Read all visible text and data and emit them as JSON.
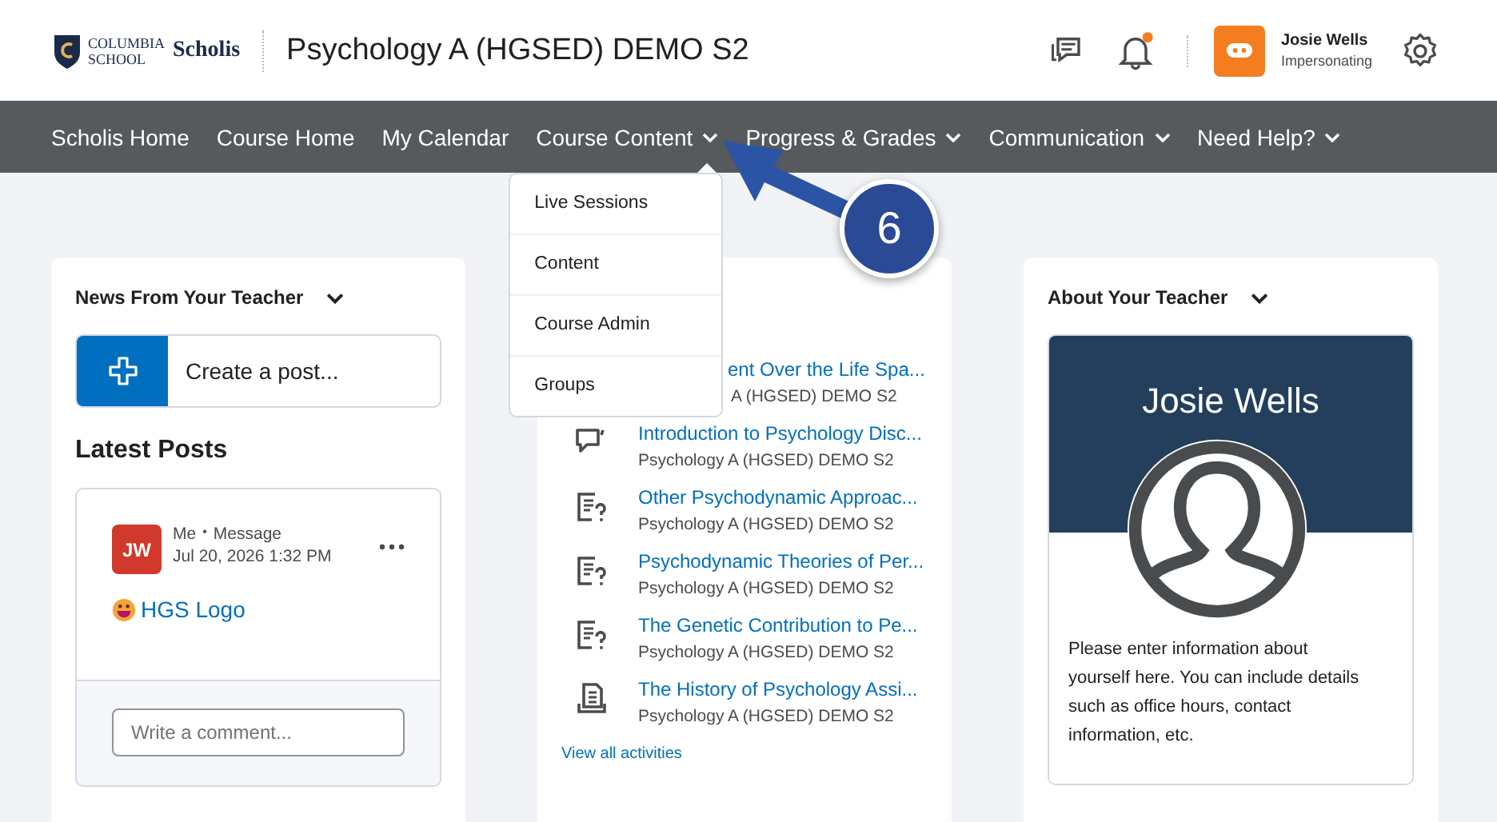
{
  "header": {
    "logo_line1": "COLUMBIA",
    "logo_line2": "SCHOOL",
    "brand": "Scholis",
    "course_title": "Psychology A (HGSED) DEMO S2",
    "notification_unread": true,
    "user_name": "Josie Wells",
    "user_status": "Impersonating"
  },
  "nav": [
    {
      "label": "Scholis Home",
      "has_caret": false,
      "expanded": false
    },
    {
      "label": "Course Home",
      "has_caret": false,
      "expanded": false
    },
    {
      "label": "My Calendar",
      "has_caret": false,
      "expanded": false
    },
    {
      "label": "Course Content",
      "has_caret": true,
      "expanded": true
    },
    {
      "label": "Progress & Grades",
      "has_caret": true,
      "expanded": false
    },
    {
      "label": "Communication",
      "has_caret": true,
      "expanded": false
    },
    {
      "label": "Need Help?",
      "has_caret": true,
      "expanded": false
    }
  ],
  "dropdown": [
    "Live Sessions",
    "Content",
    "Course Admin",
    "Groups"
  ],
  "callout": {
    "number": "6"
  },
  "news": {
    "title": "News From Your Teacher",
    "create_placeholder": "Create a post...",
    "latest_heading": "Latest Posts",
    "post": {
      "initials": "JW",
      "author": "Me",
      "separator": "•",
      "type": "Message",
      "date": "Jul 20, 2026 1:32 PM",
      "link": "HGS Logo"
    },
    "comment_placeholder": "Write a comment..."
  },
  "activities": {
    "items": [
      {
        "kind": "hidden",
        "title": "ent Over the Life Spa...",
        "course": "A (HGSED) DEMO S2"
      },
      {
        "kind": "discussion",
        "title": "Introduction to Psychology Disc...",
        "course": "Psychology A (HGSED) DEMO S2"
      },
      {
        "kind": "quiz",
        "title": "Other Psychodynamic Approac...",
        "course": "Psychology A (HGSED) DEMO S2"
      },
      {
        "kind": "quiz",
        "title": "Psychodynamic Theories of Per...",
        "course": "Psychology A (HGSED) DEMO S2"
      },
      {
        "kind": "quiz",
        "title": "The Genetic Contribution to Pe...",
        "course": "Psychology A (HGSED) DEMO S2"
      },
      {
        "kind": "assignment",
        "title": "The History of Psychology Assi...",
        "course": "Psychology A (HGSED) DEMO S2"
      }
    ],
    "view_all": "View all activities"
  },
  "teacher": {
    "title": "About Your Teacher",
    "name": "Josie Wells",
    "bio": "Please enter information about yourself here. You can include details such as office hours, contact information, etc."
  }
}
